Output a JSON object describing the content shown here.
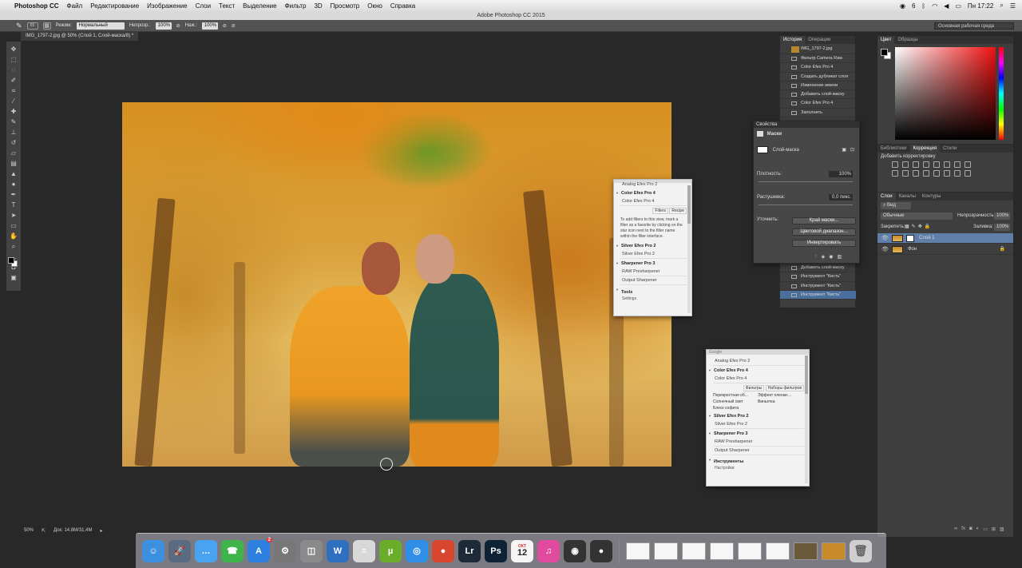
{
  "menubar": {
    "apple": "",
    "app_name": "Photoshop CC",
    "items": [
      "Файл",
      "Редактирование",
      "Изображение",
      "Слои",
      "Текст",
      "Выделение",
      "Фильтр",
      "3D",
      "Просмотр",
      "Окно",
      "Справка"
    ],
    "clock": "Пн 17:22",
    "status_indicator": "6"
  },
  "window": {
    "title": "Adobe Photoshop CC 2015"
  },
  "options_bar": {
    "brush_size": "65",
    "mode_label": "Режим:",
    "mode_value": "Нормальный",
    "opacity_label": "Непрозр.:",
    "opacity_value": "100%",
    "flow_label": "Наж.:",
    "flow_value": "100%",
    "workspace": "Основная рабочая среда"
  },
  "document": {
    "tab_title": "IMG_1797-2.jpg @ 50% (Слой 1, Слой-маска/8) *",
    "zoom": "50%",
    "doc_size": "Док: 14,8M/31,4M"
  },
  "tools": [
    "move-icon",
    "marquee-icon",
    "lasso-icon",
    "quick-select-icon",
    "crop-icon",
    "eyedropper-icon",
    "healing-icon",
    "brush-icon",
    "stamp-icon",
    "history-brush-icon",
    "eraser-icon",
    "gradient-icon",
    "blur-icon",
    "dodge-icon",
    "pen-icon",
    "type-icon",
    "path-select-icon",
    "shape-icon",
    "hand-icon",
    "zoom-icon"
  ],
  "history_panel": {
    "tabs": [
      "История",
      "Операции"
    ],
    "snapshot": "IMG_1797-2.jpg",
    "items": [
      "Фильтр Camera Raw",
      "Color Efex Pro 4",
      "Создать дубликат слоя",
      "Изменение имени",
      "Добавить слой-маску",
      "Color Efex Pro 4",
      "Заполнить"
    ],
    "items_lower": [
      "Добавить слой-маску",
      "Инструмент \"Кисть\"",
      "Инструмент \"Кисть\"",
      "Инструмент \"Кисть\""
    ]
  },
  "properties_panel": {
    "title": "Свойства",
    "section": "Маски",
    "mask_label": "Слой-маска",
    "density_label": "Плотность:",
    "density_value": "100%",
    "feather_label": "Растушевка:",
    "feather_value": "0,0 пикс.",
    "refine_label": "Уточнить:",
    "buttons": [
      "Край маски...",
      "Цветовой диапазон...",
      "Инвертировать"
    ]
  },
  "color_panel": {
    "tabs": [
      "Цвет",
      "Образцы"
    ],
    "colors": {
      "foreground": "#000000",
      "background": "#ffffff"
    }
  },
  "adjustments_panel": {
    "tabs": [
      "Библиотеки",
      "Коррекция",
      "Стили"
    ],
    "subtitle": "Добавить корректировку"
  },
  "layers_panel": {
    "tabs": [
      "Слои",
      "Каналы",
      "Контуры"
    ],
    "kind": "Вид",
    "blend_mode": "Обычные",
    "opacity_label": "Непрозрачность:",
    "opacity_value": "100%",
    "lock_label": "Закрепить:",
    "fill_label": "Заливка:",
    "fill_value": "100%",
    "layers": [
      {
        "name": "Слой 1",
        "selected": true,
        "has_mask": true
      },
      {
        "name": "Фон",
        "selected": false,
        "has_mask": false
      }
    ]
  },
  "nik_panel_en": {
    "sections": [
      {
        "title": "Analog Efex Pro 2",
        "items": []
      },
      {
        "title": "Color Efex Pro 4",
        "items": [
          "Color Efex Pro 4"
        ]
      },
      {
        "title": "Silver Efex Pro 2",
        "items": [
          "Silver Efex Pro 2"
        ]
      },
      {
        "title": "Sharpener Pro 3",
        "items": [
          "RAW Presharpener",
          "Output Sharpener"
        ]
      },
      {
        "title": "Tools",
        "items": []
      }
    ],
    "tabs": [
      "Filters",
      "Recipe"
    ],
    "help_text": "To add filters to this view, mark a filter as a favorite by clicking on the star icon next to the filter name within the filter interface.",
    "footer": "Settings"
  },
  "nik_panel_ru": {
    "title": "Google",
    "sections": [
      {
        "title": "Analog Efex Pro 2",
        "items": []
      },
      {
        "title": "Color Efex Pro 4",
        "items": [
          "Color Efex Pro 4"
        ]
      },
      {
        "title": "Silver Efex Pro 2",
        "items": [
          "Silver Efex Pro 2"
        ]
      },
      {
        "title": "Sharpener Pro 3",
        "items": [
          "RAW Presharpener",
          "Output Sharpener"
        ]
      },
      {
        "title": "Инструменты",
        "items": []
      }
    ],
    "tabs": [
      "Фильтры",
      "Наборы фильтров"
    ],
    "filters": [
      "Перекрестная об...",
      "Эффект пленки:...",
      "Солнечный свет",
      "Виньетка",
      "Блеск софита"
    ],
    "footer": "Настройки"
  },
  "dock": {
    "calendar_month": "ОКТ",
    "calendar_day": "12",
    "badge": "2",
    "apps": [
      {
        "name": "finder-icon",
        "color": "#3d8fe0",
        "glyph": "☺"
      },
      {
        "name": "launchpad-icon",
        "color": "#5a6a80",
        "glyph": "🚀"
      },
      {
        "name": "messages-icon",
        "color": "#4aa3f0",
        "glyph": "…"
      },
      {
        "name": "facetime-icon",
        "color": "#3fb44a",
        "glyph": "☎"
      },
      {
        "name": "app-store-icon",
        "color": "#2d7fe0",
        "glyph": "A"
      },
      {
        "name": "system-preferences-icon",
        "color": "#777",
        "glyph": "⚙"
      },
      {
        "name": "preview-icon",
        "color": "#8a8a8a",
        "glyph": "◫"
      },
      {
        "name": "word-icon",
        "color": "#2f6fc0",
        "glyph": "W"
      },
      {
        "name": "textedit-icon",
        "color": "#d8d8d8",
        "glyph": "≡"
      },
      {
        "name": "utorrent-icon",
        "color": "#6aad2a",
        "glyph": "µ"
      },
      {
        "name": "safari-icon",
        "color": "#2f8ee8",
        "glyph": "◎"
      },
      {
        "name": "chrome-icon",
        "color": "#d9452e",
        "glyph": "●"
      },
      {
        "name": "lightroom-icon",
        "color": "#1e2a38",
        "glyph": "Lr"
      },
      {
        "name": "photoshop-icon",
        "color": "#0e2236",
        "glyph": "Ps"
      },
      {
        "name": "calendar-icon",
        "color": "#f5f5f5",
        "glyph": ""
      },
      {
        "name": "itunes-icon",
        "color": "#e04ba0",
        "glyph": "♫"
      },
      {
        "name": "image-capture-icon",
        "color": "#333",
        "glyph": "◉"
      },
      {
        "name": "screen-recorder-icon",
        "color": "#333",
        "glyph": "●"
      }
    ],
    "trash_icon": "trash-icon"
  }
}
